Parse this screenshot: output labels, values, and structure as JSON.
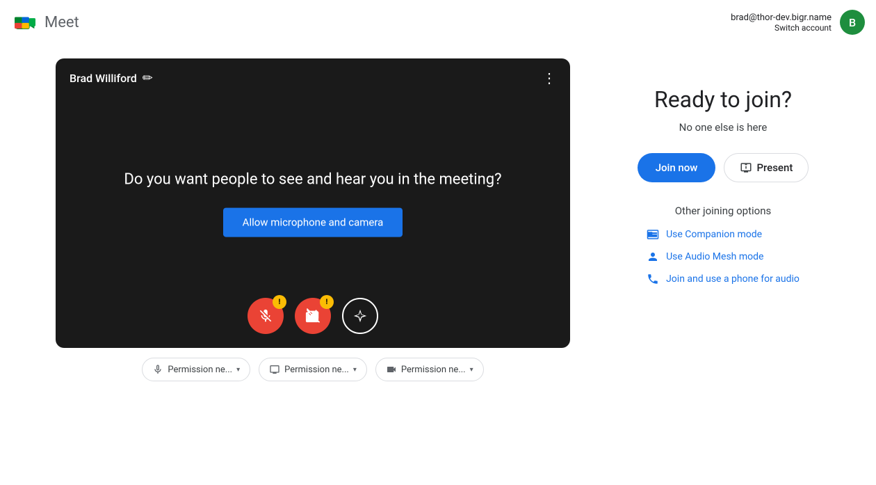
{
  "header": {
    "app_name": "Meet",
    "account_email": "brad@thor-dev.bigr.name",
    "account_switch_label": "Switch account",
    "avatar_letter": "B",
    "avatar_color": "#1e8e3e"
  },
  "video": {
    "user_name": "Brad Williford",
    "question_text": "Do you want people to see and hear you in the meeting?",
    "allow_btn_label": "Allow microphone and camera"
  },
  "permissions": {
    "mic_label": "Permission ne...",
    "screen_label": "Permission ne...",
    "camera_label": "Permission ne..."
  },
  "right_panel": {
    "ready_title": "Ready to join?",
    "no_one_text": "No one else is here",
    "join_now_label": "Join now",
    "present_label": "Present",
    "other_options_title": "Other joining options",
    "companion_label": "Use Companion mode",
    "audio_mesh_label": "Use Audio Mesh mode",
    "phone_label": "Join and use a phone for audio"
  }
}
